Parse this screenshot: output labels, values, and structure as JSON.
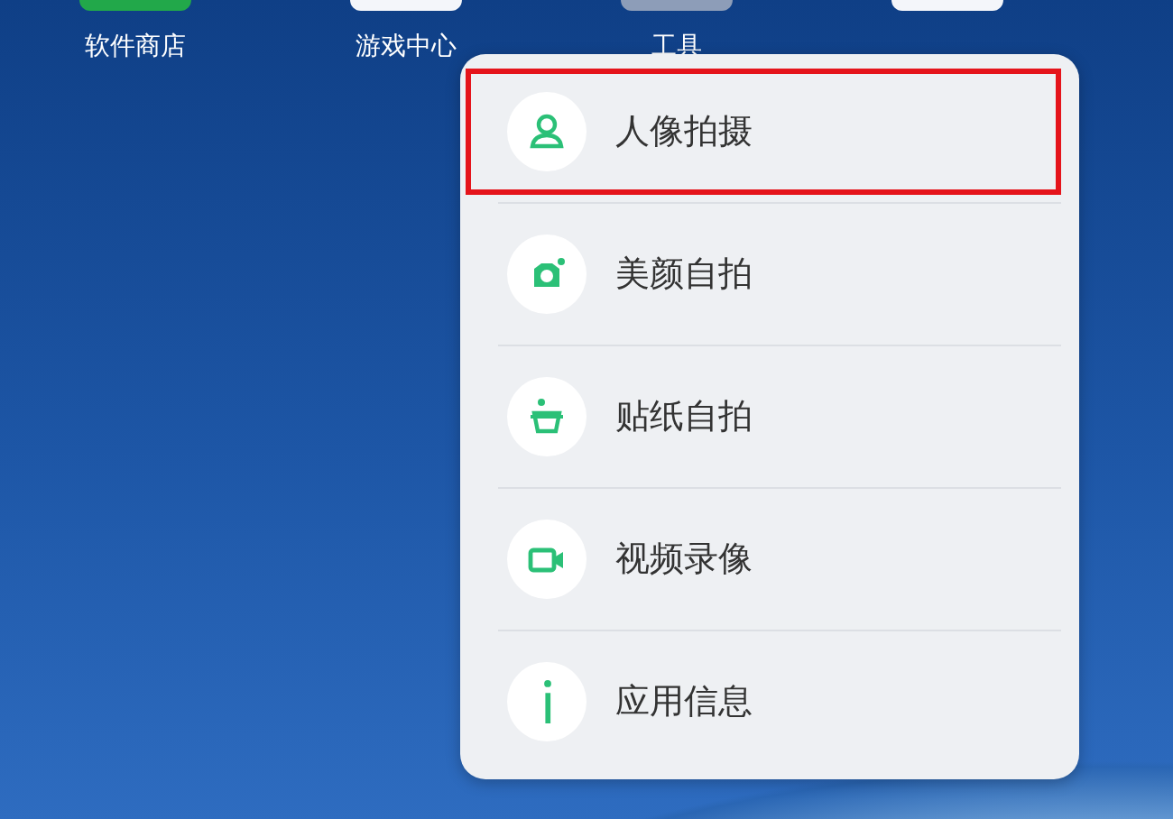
{
  "home_apps": [
    {
      "label": "软件商店",
      "color": "#22a84a"
    },
    {
      "label": "游戏中心",
      "color": "#f4f6fa"
    },
    {
      "label": "工具",
      "color": "#8d9db8"
    },
    {
      "color": "#f4f6fa"
    }
  ],
  "menu": {
    "items": [
      {
        "kind": "portrait",
        "label": "人像拍摄",
        "selected": true
      },
      {
        "kind": "beauty",
        "label": "美颜自拍",
        "selected": false
      },
      {
        "kind": "sticker",
        "label": "贴纸自拍",
        "selected": false
      },
      {
        "kind": "video",
        "label": "视频录像",
        "selected": false
      },
      {
        "kind": "info",
        "label": "应用信息",
        "selected": false
      }
    ]
  }
}
